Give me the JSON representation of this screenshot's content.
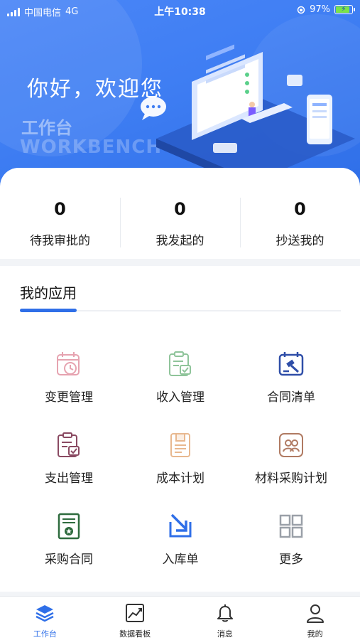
{
  "status_bar": {
    "carrier": "中国电信",
    "network": "4G",
    "time": "上午10:38",
    "battery_percent": "97%",
    "battery_level": 0.97
  },
  "hero": {
    "greeting": "你好，欢迎您",
    "workbench_cn": "工作台",
    "workbench_en": "WORKBENCH"
  },
  "stats": [
    {
      "value": "0",
      "label": "待我审批的"
    },
    {
      "value": "0",
      "label": "我发起的"
    },
    {
      "value": "0",
      "label": "抄送我的"
    }
  ],
  "apps": {
    "title": "我的应用",
    "items": [
      {
        "label": "变更管理",
        "icon": "calendar-clock-icon",
        "color": "#e6a3b0"
      },
      {
        "label": "收入管理",
        "icon": "clipboard-check-icon",
        "color": "#8fc49a"
      },
      {
        "label": "合同清单",
        "icon": "calendar-gavel-icon",
        "color": "#2f4ea8"
      },
      {
        "label": "支出管理",
        "icon": "clipboard-list-icon",
        "color": "#8a4a62"
      },
      {
        "label": "成本计划",
        "icon": "document-icon",
        "color": "#e8b88f"
      },
      {
        "label": "材料采购计划",
        "icon": "people-icon",
        "color": "#b07a62"
      },
      {
        "label": "采购合同",
        "icon": "certificate-icon",
        "color": "#2e6b3e"
      },
      {
        "label": "入库单",
        "icon": "inbox-arrow-icon",
        "color": "#2f6fe8"
      },
      {
        "label": "更多",
        "icon": "grid-icon",
        "color": "#9aa0a8"
      }
    ]
  },
  "tabbar": {
    "tabs": [
      {
        "label": "工作台",
        "icon": "layers-icon",
        "active": true
      },
      {
        "label": "数据看板",
        "icon": "chart-board-icon",
        "active": false
      },
      {
        "label": "消息",
        "icon": "bell-icon",
        "active": false
      },
      {
        "label": "我的",
        "icon": "user-icon",
        "active": false
      }
    ],
    "accent": "#2f6fe8"
  }
}
